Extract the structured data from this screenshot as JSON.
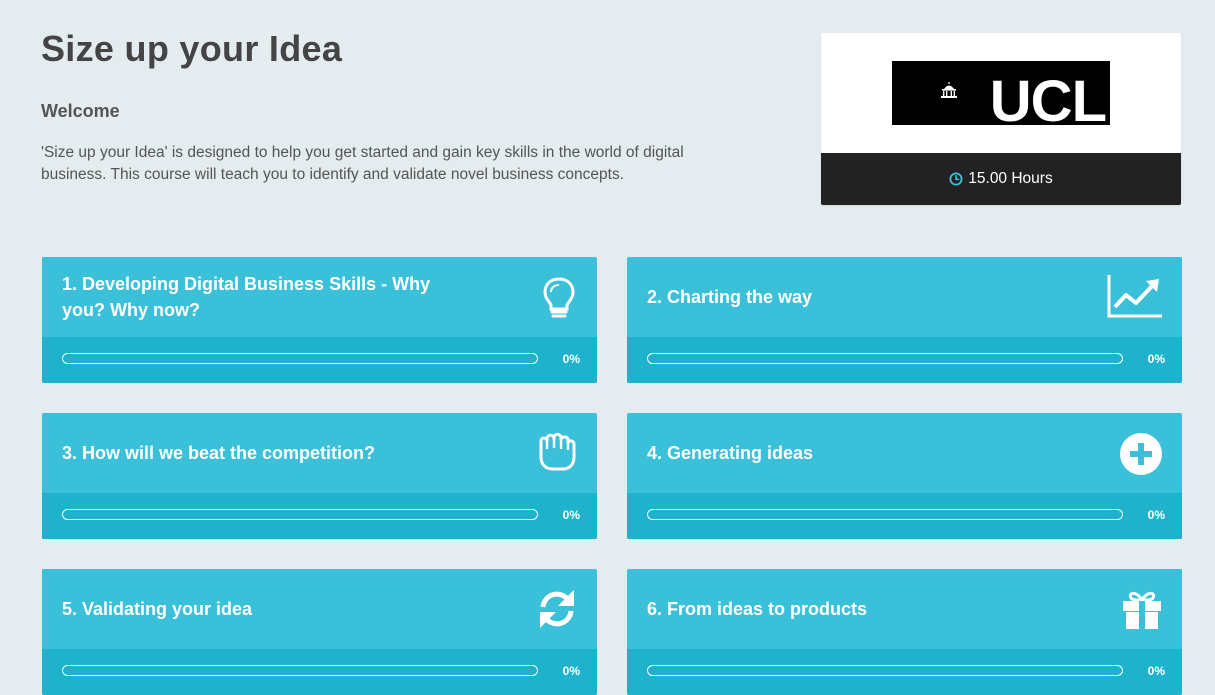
{
  "page": {
    "title": "Size up your Idea",
    "welcome_heading": "Welcome",
    "description": "'Size up your Idea' is designed to help you get started and gain key skills in the world of digital business. This course will teach you to identify and validate novel business concepts."
  },
  "brand": {
    "logo_text": "UCL",
    "duration": "15.00 Hours",
    "duration_icon": "clock-icon"
  },
  "colors": {
    "background": "#e4ecef",
    "module_head": "#3ac0d8",
    "module_foot": "#1eb2cd",
    "clock": "#3ac0d8"
  },
  "modules": [
    {
      "title": "1. Developing Digital Business Skills - Why you? Why now?",
      "progress": "0%",
      "icon": "lightbulb-icon"
    },
    {
      "title": "2. Charting the way",
      "progress": "0%",
      "icon": "line-chart-icon"
    },
    {
      "title": "3. How will we beat the competition?",
      "progress": "0%",
      "icon": "fist-icon"
    },
    {
      "title": "4. Generating ideas",
      "progress": "0%",
      "icon": "plus-circle-icon"
    },
    {
      "title": "5. Validating your idea",
      "progress": "0%",
      "icon": "refresh-icon"
    },
    {
      "title": "6. From ideas to products",
      "progress": "0%",
      "icon": "gift-icon"
    }
  ]
}
